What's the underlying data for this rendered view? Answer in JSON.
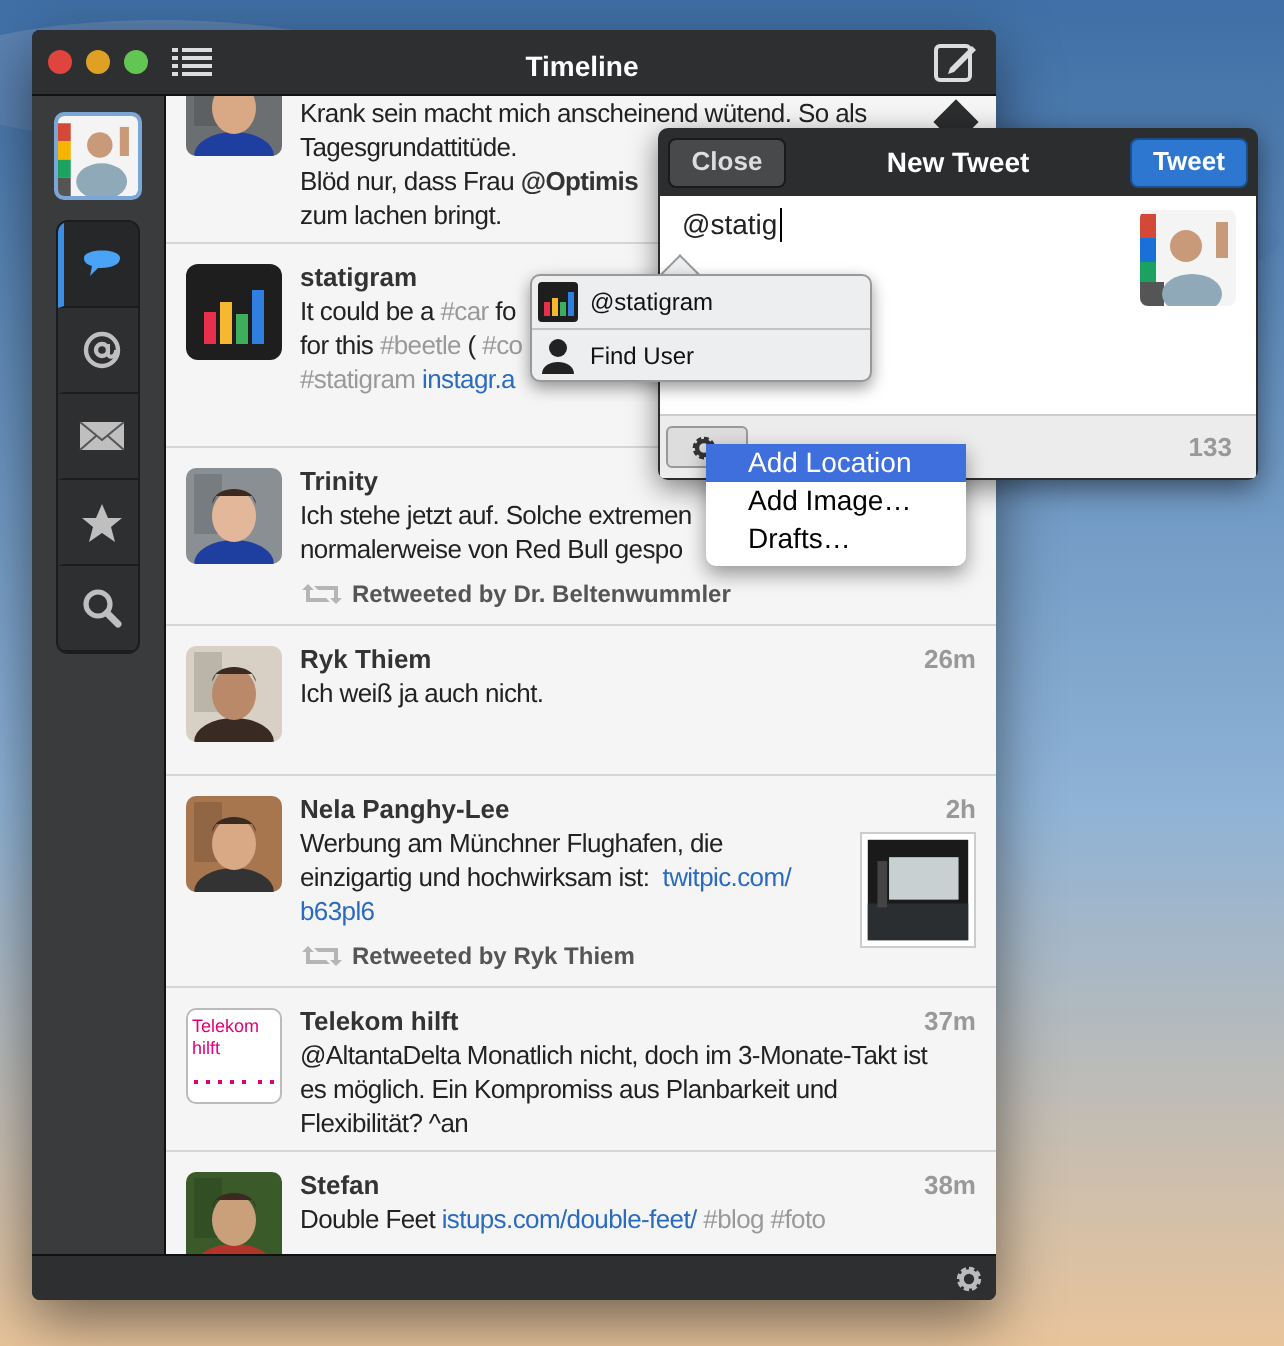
{
  "window": {
    "title": "Timeline"
  },
  "sidebar": {
    "tabs": [
      {
        "selected": true
      },
      {
        "selected": false
      },
      {
        "selected": false
      },
      {
        "selected": false
      },
      {
        "selected": false
      }
    ]
  },
  "timeline": [
    {
      "lines": [
        [
          {
            "kind": "plain",
            "text": "Krank sein macht mich anscheinend wütend. So als"
          }
        ],
        [
          {
            "kind": "plain",
            "text": "Tagesgrundattitüde."
          }
        ],
        [
          {
            "kind": "plain",
            "text": "Blöd nur, dass Frau "
          },
          {
            "kind": "mention",
            "text": "@Optimis"
          }
        ],
        [
          {
            "kind": "plain",
            "text": "zum lachen bringt."
          }
        ]
      ]
    },
    {
      "kind": "chart-logo",
      "name": "statigram",
      "lines": [
        [
          {
            "kind": "plain",
            "text": "It could be a "
          },
          {
            "kind": "tag",
            "text": "#car"
          },
          {
            "kind": "plain",
            "text": " fo"
          }
        ],
        [
          {
            "kind": "plain",
            "text": "for this "
          },
          {
            "kind": "tag",
            "text": "#beetle"
          },
          {
            "kind": "plain",
            "text": " ( "
          },
          {
            "kind": "tag",
            "text": "#co"
          }
        ],
        [
          {
            "kind": "tag",
            "text": "#statigram"
          },
          {
            "kind": "link",
            "text": " instagr.a"
          }
        ]
      ]
    },
    {
      "name": "Trinity",
      "lines": [
        [
          {
            "kind": "plain",
            "text": "Ich stehe jetzt auf. Solche extremen"
          }
        ],
        [
          {
            "kind": "plain",
            "text": "normalerweise von Red Bull gespo"
          }
        ]
      ],
      "retweet": "Retweeted by Dr. Beltenwummler"
    },
    {
      "name": "Ryk Thiem",
      "time": "26m",
      "lines": [
        [
          {
            "kind": "plain",
            "text": "Ich weiß ja auch nicht."
          }
        ]
      ]
    },
    {
      "name": "Nela Panghy-Lee",
      "time": "2h",
      "lines": [
        [
          {
            "kind": "plain",
            "text": "Werbung am Münchner Flughafen, die"
          }
        ],
        [
          {
            "kind": "plain",
            "text": "einzigartig und hochwirksam ist:  "
          },
          {
            "kind": "link",
            "text": "twitpic.com/"
          }
        ],
        [
          {
            "kind": "link",
            "text": "b63pl6"
          }
        ]
      ],
      "thumbnail": {
        "kind": "picture"
      },
      "retweet": "Retweeted by Ryk Thiem"
    },
    {
      "kind": "text-logo",
      "avatar_text": "Telekom hilft",
      "name": "Telekom hilft",
      "time": "37m",
      "lines": [
        [
          {
            "kind": "plain",
            "text": "@AltantaDelta Monatlich nicht, doch im 3-Monate-Takt ist"
          }
        ],
        [
          {
            "kind": "plain",
            "text": "es möglich. Ein Kompromiss aus Planbarkeit und"
          }
        ],
        [
          {
            "kind": "plain",
            "text": "Flexibilität? ^an"
          }
        ]
      ]
    },
    {
      "name": "Stefan",
      "time": "38m",
      "lines": [
        [
          {
            "kind": "plain",
            "text": "Double Feet "
          },
          {
            "kind": "link",
            "text": "istups.com/double-feet/"
          },
          {
            "kind": "tag",
            "text": " #blog #foto"
          }
        ]
      ]
    }
  ],
  "compose": {
    "title": "New Tweet",
    "close": "Close",
    "send": "Tweet",
    "value": "@statig",
    "counter": "133"
  },
  "autocomplete": [
    {
      "kind": "user",
      "label": "@statigram"
    },
    {
      "kind": "find",
      "label": "Find User"
    }
  ],
  "menu": [
    {
      "label": "Add Location",
      "selected": true
    },
    {
      "label": "Add Image…",
      "selected": false
    },
    {
      "label": "Drafts…",
      "selected": false
    }
  ]
}
